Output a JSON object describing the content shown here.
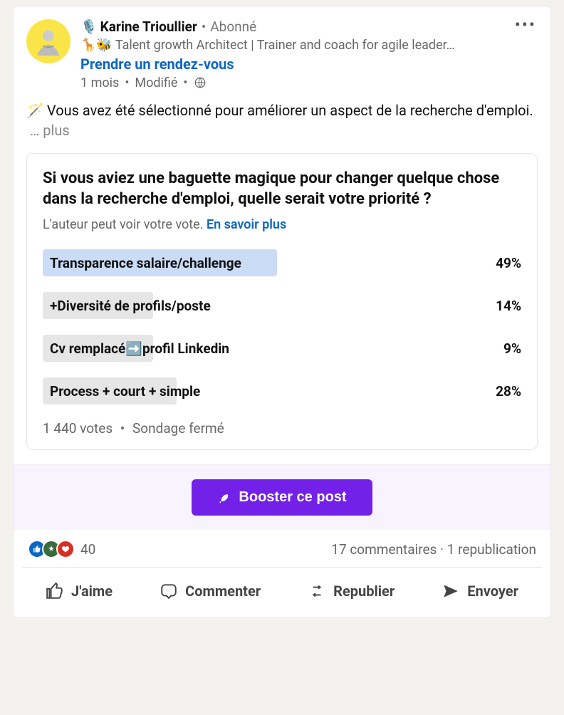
{
  "author": {
    "name_emoji": "🎙️",
    "name": "Karine Trioullier",
    "sep": "•",
    "follows": "Abonné",
    "headline_prefix": "🦒🐝",
    "headline": "Talent growth Architect | Trainer and coach for agile leader…",
    "appointment": "Prendre un rendez-vous",
    "time": "1 mois",
    "edited": "Modifié"
  },
  "body": {
    "emoji": "🪄",
    "text": "Vous avez été sélectionné pour améliorer un aspect de la recherche d'emploi.",
    "see_more": "… plus"
  },
  "poll": {
    "question": "Si vous aviez une baguette magique pour changer quelque chose dans la recherche d'emploi, quelle serait votre priorité ?",
    "sub_prefix": "L'auteur peut voir votre vote.",
    "sub_link": "En savoir plus",
    "options": [
      {
        "label": "Transparence salaire/challenge",
        "pct": "49%",
        "width": 49,
        "selected": true
      },
      {
        "label": "+Diversité de profils/poste",
        "pct": "14%",
        "width": 14,
        "selected": false
      },
      {
        "label": "Cv remplacé➡️profil Linkedin",
        "pct": "9%",
        "width": 9,
        "selected": false
      },
      {
        "label": "Process + court + simple",
        "pct": "28%",
        "width": 28,
        "selected": false
      }
    ],
    "votes": "1 440 votes",
    "closed": "Sondage fermé"
  },
  "boost": {
    "label": "Booster ce post"
  },
  "social": {
    "count": "40",
    "comments": "17 commentaires",
    "reposts": "1 republication"
  },
  "actions": {
    "like": "J'aime",
    "comment": "Commenter",
    "repost": "Republier",
    "send": "Envoyer"
  }
}
